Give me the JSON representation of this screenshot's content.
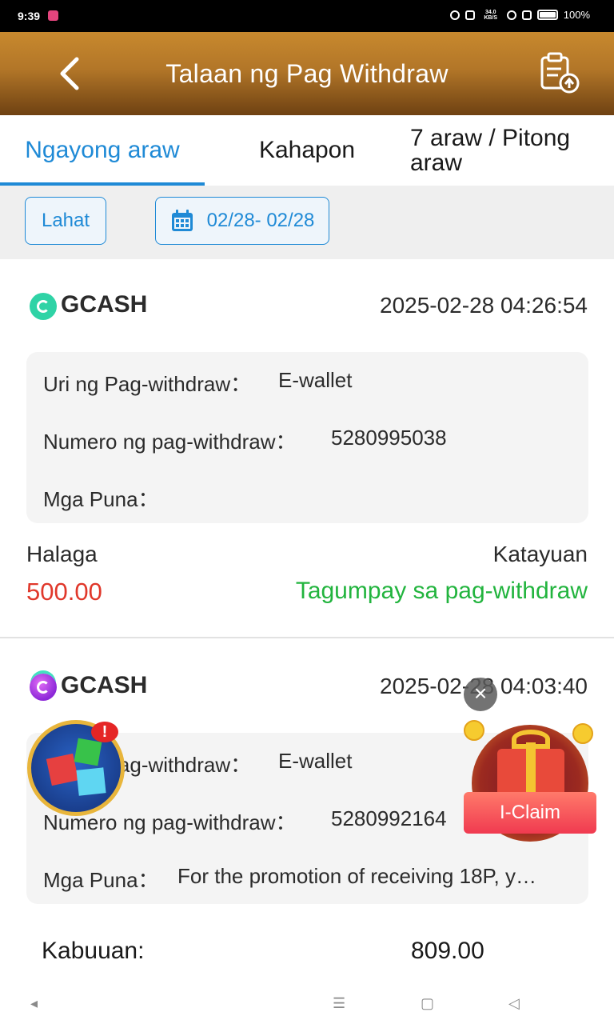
{
  "status_bar": {
    "time": "9:39",
    "network_speed": "34.0 KB/S",
    "battery": "100%"
  },
  "header": {
    "title": "Talaan ng Pag Withdraw"
  },
  "tabs": [
    {
      "label": "Ngayong araw",
      "active": true
    },
    {
      "label": "Kahapon",
      "active": false
    },
    {
      "label": "7 araw / Pitong araw",
      "active": false
    }
  ],
  "filters": {
    "type_label": "Lahat",
    "date_range": "02/28- 02/28"
  },
  "records": [
    {
      "method": "GCASH",
      "datetime": "2025-02-28 04:26:54",
      "type_label": "Uri ng Pag-withdraw：",
      "type_value": "E-wallet",
      "number_label": "Numero ng pag-withdraw：",
      "number_value": "5280995038",
      "remarks_label": "Mga Puna：",
      "remarks_value": "",
      "amount_label": "Halaga",
      "amount_value": "500.00",
      "status_label": "Katayuan",
      "status_value": "Tagumpay sa pag-withdraw"
    },
    {
      "method": "GCASH",
      "datetime": "2025-02-28 04:03:40",
      "type_label": "Uri ng Pag-withdraw：",
      "type_value": "E-wallet",
      "number_label": "Numero ng pag-withdraw：",
      "number_value": "5280992164",
      "remarks_label": "Mga Puna：",
      "remarks_value": "For the promotion of receiving 18P, y…"
    }
  ],
  "total": {
    "label": "Kabuuan:",
    "value": "809.00"
  },
  "floating": {
    "claim_label": "I-Claim",
    "alert_badge": "!",
    "close_glyph": "×"
  },
  "colors": {
    "accent_blue": "#1f8ad6",
    "amount_red": "#e0382b",
    "success_green": "#22b43e",
    "header_gold": "#b27628"
  },
  "icons": [
    "back-arrow-icon",
    "clipboard-upload-icon",
    "calendar-icon",
    "gcash-logo-icon",
    "close-icon",
    "gift-icon",
    "cube-game-icon"
  ]
}
